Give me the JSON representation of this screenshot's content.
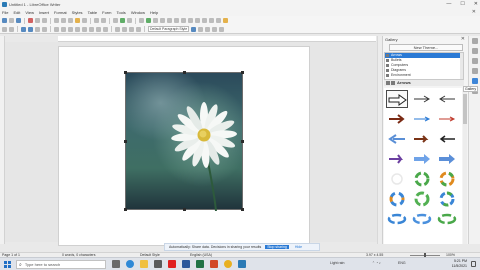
{
  "window": {
    "title": "Untitled 1 - LibreOffice Writer",
    "controls": [
      "—",
      "☐",
      "✕"
    ]
  },
  "menu": [
    "File",
    "Edit",
    "View",
    "Insert",
    "Format",
    "Styles",
    "Table",
    "Form",
    "Tools",
    "Window",
    "Help"
  ],
  "toolbar": {
    "paragraph_style": "Default Paragraph Style",
    "font_name": "Liberation Serif",
    "font_size": "12 pt"
  },
  "sidebar": {
    "title": "Gallery",
    "new_theme_button": "New Theme...",
    "themes": [
      "Arrows",
      "Bullets",
      "Computers",
      "Diagrams",
      "Environment"
    ],
    "selected_theme": "Arrows",
    "gallery_label": "Arrows",
    "tooltip": "Gallery"
  },
  "infobar": {
    "message": "Automatically: Share data. Decisions in sharing your results",
    "primary_button": "Stop sharing",
    "secondary_button": "Hide"
  },
  "status": {
    "page": "Page 1 of 1",
    "words": "0 words, 0 characters",
    "style": "Default Style",
    "language": "English (USA)",
    "size": "3.97 x 4.55",
    "zoom": "100%"
  },
  "taskbar": {
    "search_placeholder": "Type here to search",
    "weather": "Light rain",
    "lang": "ENG",
    "time": "5:21 PM",
    "date": "11/5/2021"
  },
  "colors": {
    "accent": "#2a7ad5",
    "document_bg": "#e6e6e6",
    "page": "#ffffff"
  }
}
